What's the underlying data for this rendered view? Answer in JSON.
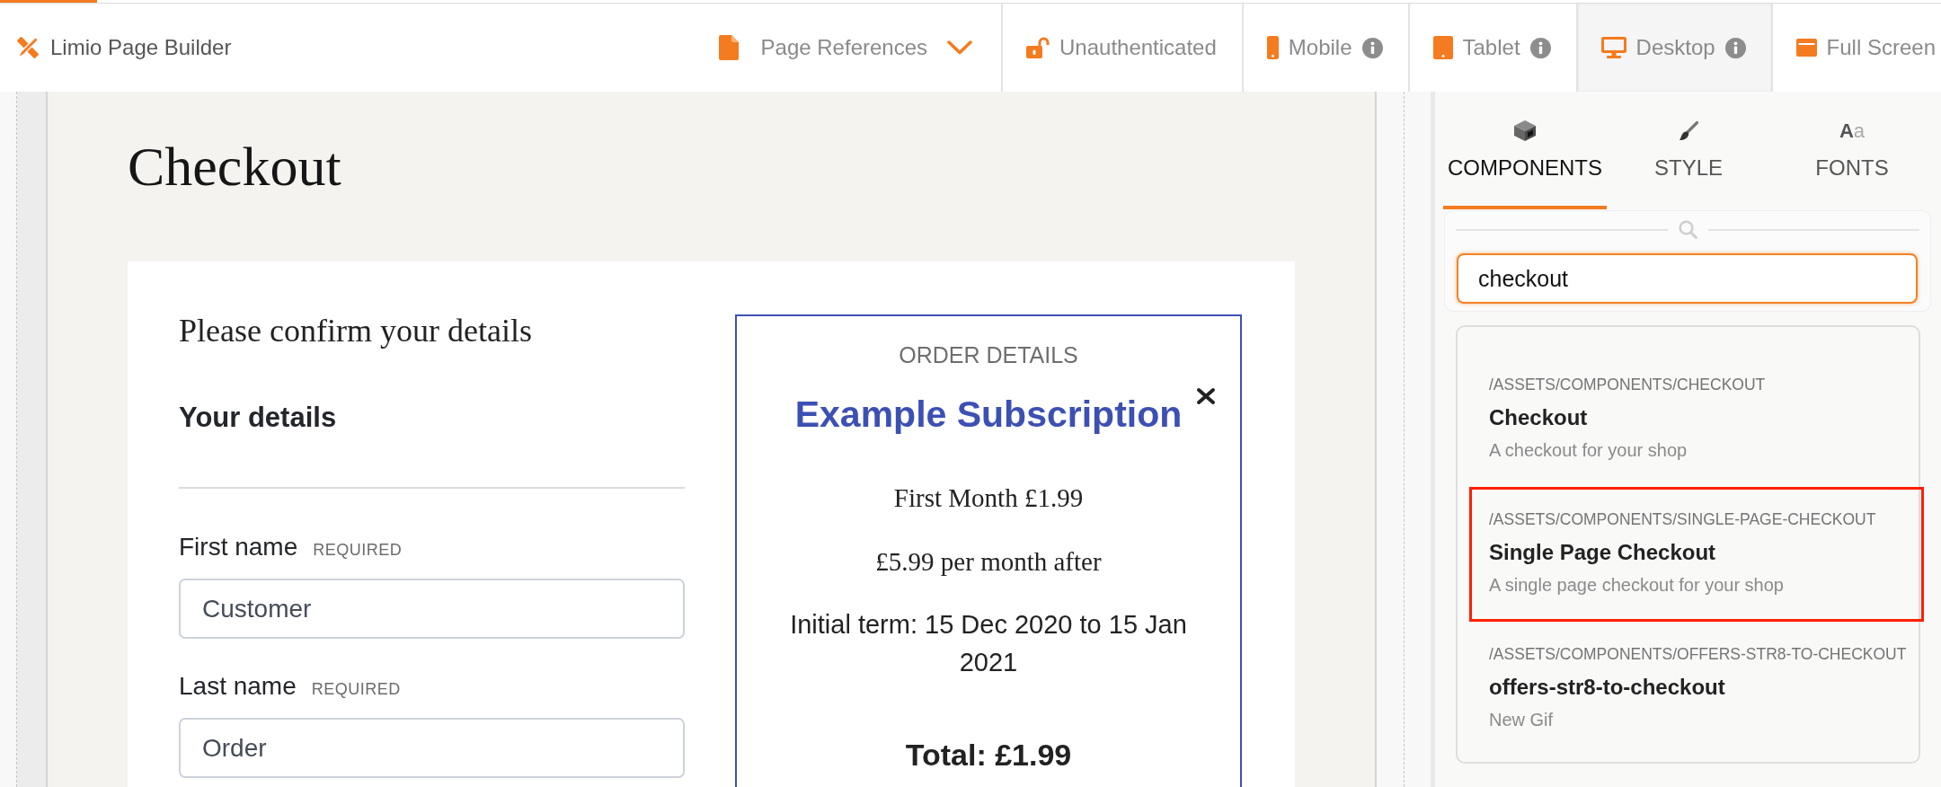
{
  "loading_bar": {
    "level": 0.05
  },
  "toolbar": {
    "app_title": "Limio Page Builder",
    "page_references": {
      "label": "Page References"
    },
    "auth": {
      "label": "Unauthenticated"
    },
    "views": [
      {
        "kind": "mobile",
        "label": "Mobile",
        "info": true,
        "selected": false
      },
      {
        "kind": "tablet",
        "label": "Tablet",
        "info": true,
        "selected": false
      },
      {
        "kind": "desktop",
        "label": "Desktop",
        "info": true,
        "selected": true
      },
      {
        "kind": "fullscreen",
        "label": "Full Screen",
        "info": false,
        "selected": false
      }
    ]
  },
  "page": {
    "title": "Checkout",
    "intro": "Please confirm your details",
    "section_title": "Your details",
    "fields": [
      {
        "label": "First name",
        "tag": "REQUIRED",
        "value": "Customer"
      },
      {
        "label": "Last name",
        "tag": "REQUIRED",
        "value": "Order"
      }
    ],
    "order": {
      "heading": "ORDER DETAILS",
      "product": "Example Subscription",
      "lines": [
        {
          "kind": "price",
          "text": "First Month £1.99"
        },
        {
          "kind": "price",
          "text": "£5.99 per month after"
        },
        {
          "kind": "term",
          "text": "Initial term: 15 Dec 2020 to 15 Jan 2021"
        }
      ],
      "total": "Total: £1.99"
    }
  },
  "panel": {
    "tabs": [
      {
        "kind": "components",
        "label": "COMPONENTS",
        "selected": true
      },
      {
        "kind": "style",
        "label": "STYLE",
        "selected": false
      },
      {
        "kind": "fonts",
        "label": "FONTS",
        "glyph": "Aa",
        "selected": false
      }
    ],
    "search": {
      "value": "checkout"
    },
    "results": [
      {
        "path": "/ASSETS/COMPONENTS/CHECKOUT",
        "title": "Checkout",
        "description": "A checkout for your shop",
        "selected": false
      },
      {
        "path": "/ASSETS/COMPONENTS/SINGLE-PAGE-CHECKOUT",
        "title": "Single Page Checkout",
        "description": "A single page checkout for your shop",
        "selected": true
      },
      {
        "path": "/ASSETS/COMPONENTS/OFFERS-STR8-TO-CHECKOUT",
        "title": "offers-str8-to-checkout",
        "description": "New Gif",
        "selected": false
      }
    ]
  }
}
